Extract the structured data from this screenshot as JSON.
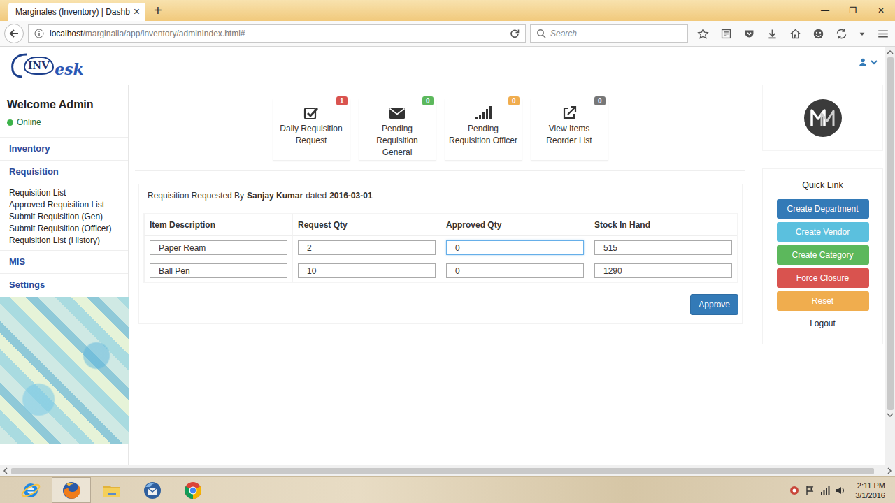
{
  "browser": {
    "tab": {
      "title": "Marginales (Inventory) | Dashb",
      "close": "×"
    },
    "new_tab": "+",
    "window_controls": [
      "—",
      "❐",
      "✕"
    ],
    "url_host": "localhost",
    "url_path": "/marginalia/app/inventory/adminIndex.html#",
    "search_placeholder": "Search"
  },
  "app": {
    "logo": {
      "boxed": "INV",
      "script": "esk"
    },
    "sidebar": {
      "welcome": "Welcome Admin",
      "status": {
        "label": "Online",
        "color": "#3cb34a"
      },
      "sections": [
        {
          "label": "Inventory",
          "items": []
        },
        {
          "label": "Requisition",
          "items": [
            "Requisition List",
            "Approved Requisition List",
            "Submit Requisition (Gen)",
            "Submit Requisition (Officer)",
            "Requisition List (History)"
          ]
        },
        {
          "label": "MIS",
          "items": []
        },
        {
          "label": "Settings",
          "items": []
        }
      ]
    },
    "shortcuts": [
      {
        "label": "Daily Requisition Request",
        "badge": "1",
        "color": "#d9534f",
        "kind": "check"
      },
      {
        "label": "Pending Requisition General",
        "badge": "0",
        "color": "#5cb85c",
        "kind": "envelope"
      },
      {
        "label": "Pending Requisition Officer",
        "badge": "0",
        "color": "#f0ad4e",
        "kind": "signal"
      },
      {
        "label": "View Items Reorder List",
        "badge": "0",
        "color": "#777777",
        "kind": "external"
      }
    ],
    "requisition": {
      "requested_by_label": "Requisition Requested By",
      "requester": "Sanjay Kumar",
      "dated_label": "dated",
      "date": "2016-03-01",
      "columns": [
        "Item Description",
        "Request Qty",
        "Approved Qty",
        "Stock In Hand"
      ],
      "rows": [
        {
          "item": "Paper Ream",
          "request_qty": "2",
          "approved_qty": "0",
          "stock": "515",
          "approved_focused": true
        },
        {
          "item": "Ball Pen",
          "request_qty": "10",
          "approved_qty": "0",
          "stock": "1290",
          "approved_focused": false
        }
      ],
      "approve": "Approve"
    },
    "quick_links": {
      "title": "Quick Link",
      "buttons": [
        {
          "label": "Create Department",
          "color": "#337ab7"
        },
        {
          "label": "Create Vendor",
          "color": "#5bc0de"
        },
        {
          "label": "Create Category",
          "color": "#5cb85c"
        },
        {
          "label": "Force Closure",
          "color": "#d9534f"
        },
        {
          "label": "Reset",
          "color": "#f0ad4e"
        }
      ],
      "logout": "Logout"
    }
  },
  "taskbar": {
    "apps": [
      {
        "kind": "ie",
        "active": false
      },
      {
        "kind": "firefox",
        "active": true
      },
      {
        "kind": "folder",
        "active": false
      },
      {
        "kind": "thunderbird",
        "active": false
      },
      {
        "kind": "chrome",
        "active": false
      }
    ],
    "time": "2:11 PM",
    "date": "3/1/2016"
  }
}
